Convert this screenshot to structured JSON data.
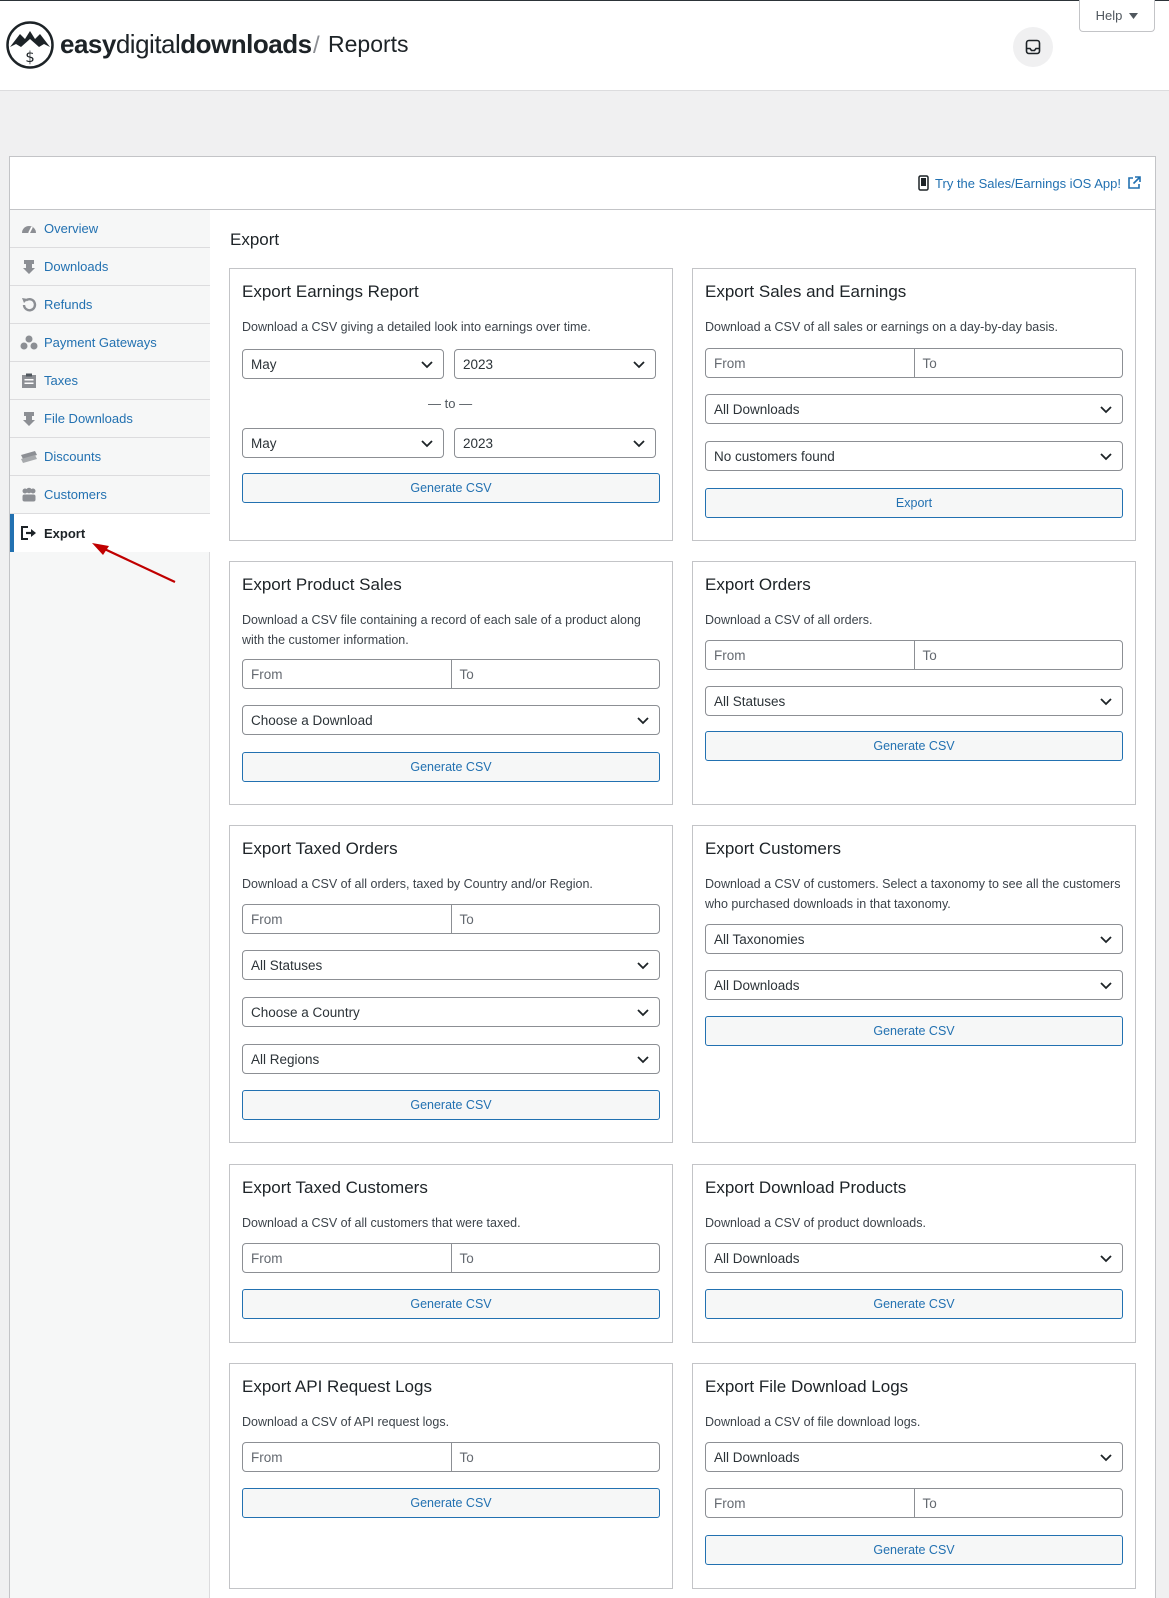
{
  "header": {
    "brand_bold1": "easy",
    "brand_light": "digital",
    "brand_bold2": "downloads",
    "separator": "/",
    "page": "Reports",
    "help_label": "Help",
    "ios_link": "Try the Sales/Earnings iOS App!"
  },
  "sidebar": {
    "items": [
      {
        "label": "Overview",
        "icon": "dashboard-icon"
      },
      {
        "label": "Downloads",
        "icon": "download-icon"
      },
      {
        "label": "Refunds",
        "icon": "undo-icon"
      },
      {
        "label": "Payment Gateways",
        "icon": "groups-icon"
      },
      {
        "label": "Taxes",
        "icon": "clipboard-icon"
      },
      {
        "label": "File Downloads",
        "icon": "download-icon"
      },
      {
        "label": "Discounts",
        "icon": "tickets-icon"
      },
      {
        "label": "Customers",
        "icon": "people-icon"
      },
      {
        "label": "Export",
        "icon": "export-icon",
        "active": true
      }
    ]
  },
  "main": {
    "title": "Export",
    "cards": {
      "earnings": {
        "title": "Export Earnings Report",
        "desc": "Download a CSV giving a detailed look into earnings over time.",
        "start_month": "May",
        "start_year": "2023",
        "to": "— to —",
        "end_month": "May",
        "end_year": "2023",
        "button": "Generate CSV"
      },
      "sales": {
        "title": "Export Sales and Earnings",
        "desc": "Download a CSV of all sales or earnings on a day-by-day basis.",
        "from": "From",
        "to": "To",
        "downloads": "All Downloads",
        "customers": "No customers found",
        "button": "Export"
      },
      "product_sales": {
        "title": "Export Product Sales",
        "desc": "Download a CSV file containing a record of each sale of a product along with the customer information.",
        "from": "From",
        "to": "To",
        "download": "Choose a Download",
        "button": "Generate CSV"
      },
      "orders": {
        "title": "Export Orders",
        "desc": "Download a CSV of all orders.",
        "from": "From",
        "to": "To",
        "status": "All Statuses",
        "button": "Generate CSV"
      },
      "taxed_orders": {
        "title": "Export Taxed Orders",
        "desc": "Download a CSV of all orders, taxed by Country and/or Region.",
        "from": "From",
        "to": "To",
        "status": "All Statuses",
        "country": "Choose a Country",
        "region": "All Regions",
        "button": "Generate CSV"
      },
      "customers": {
        "title": "Export Customers",
        "desc": "Download a CSV of customers. Select a taxonomy to see all the customers who purchased downloads in that taxonomy.",
        "taxonomy": "All Taxonomies",
        "downloads": "All Downloads",
        "button": "Generate CSV"
      },
      "taxed_customers": {
        "title": "Export Taxed Customers",
        "desc": "Download a CSV of all customers that were taxed.",
        "from": "From",
        "to": "To",
        "button": "Generate CSV"
      },
      "download_products": {
        "title": "Export Download Products",
        "desc": "Download a CSV of product downloads.",
        "downloads": "All Downloads",
        "button": "Generate CSV"
      },
      "api_logs": {
        "title": "Export API Request Logs",
        "desc": "Download a CSV of API request logs.",
        "from": "From",
        "to": "To",
        "button": "Generate CSV"
      },
      "file_logs": {
        "title": "Export File Download Logs",
        "desc": "Download a CSV of file download logs.",
        "downloads": "All Downloads",
        "from": "From",
        "to": "To",
        "button": "Generate CSV"
      }
    }
  },
  "colors": {
    "link": "#2271b1",
    "arrow": "#c00000"
  }
}
